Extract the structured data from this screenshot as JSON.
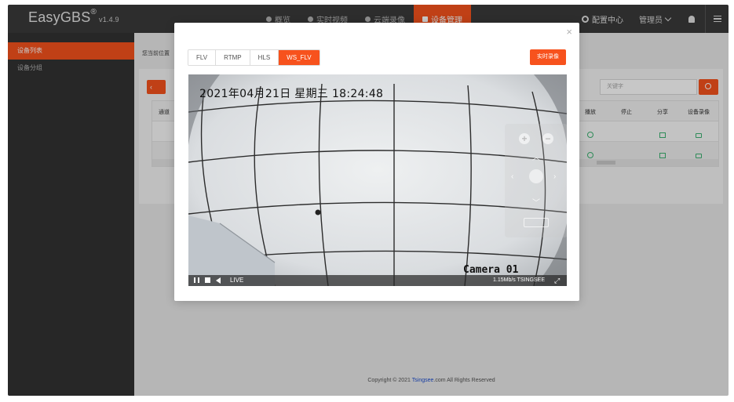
{
  "app": {
    "name": "EasyGBS",
    "reg": "®",
    "version": "v1.4.9"
  },
  "nav": {
    "items": [
      {
        "label": "概览"
      },
      {
        "label": "实时视频"
      },
      {
        "label": "云端录像"
      },
      {
        "label": "设备管理"
      },
      {
        "label": "配置中心"
      }
    ],
    "active_index": 3,
    "admin_label": "管理员"
  },
  "sidebar": {
    "items": [
      {
        "label": "设备列表"
      },
      {
        "label": "设备分组"
      }
    ]
  },
  "main": {
    "breadcrumb": "您当前位置",
    "search_placeholder": "关键字",
    "table": {
      "headers": [
        "通道",
        "播放",
        "停止",
        "分享",
        "设备录像"
      ]
    },
    "footer": {
      "prefix": "Copyright © 2021",
      "brand": "Tsingsee",
      "suffix": ".com All Rights Reserved"
    }
  },
  "modal": {
    "close_symbol": "×",
    "tabs": [
      "FLV",
      "RTMP",
      "HLS",
      "WS_FLV"
    ],
    "active_tab": "WS_FLV",
    "record_button": "实时录像",
    "video": {
      "osd_datetime": "2021年04月21日  星期三  18:24:48",
      "camera_label": "Camera 01",
      "live_label": "LIVE",
      "bitrate": "1.15Mb/s TSINGSEE"
    }
  },
  "colors": {
    "accent": "#f7521d",
    "topbar": "#3a3a3a",
    "sidebar": "#333333"
  }
}
